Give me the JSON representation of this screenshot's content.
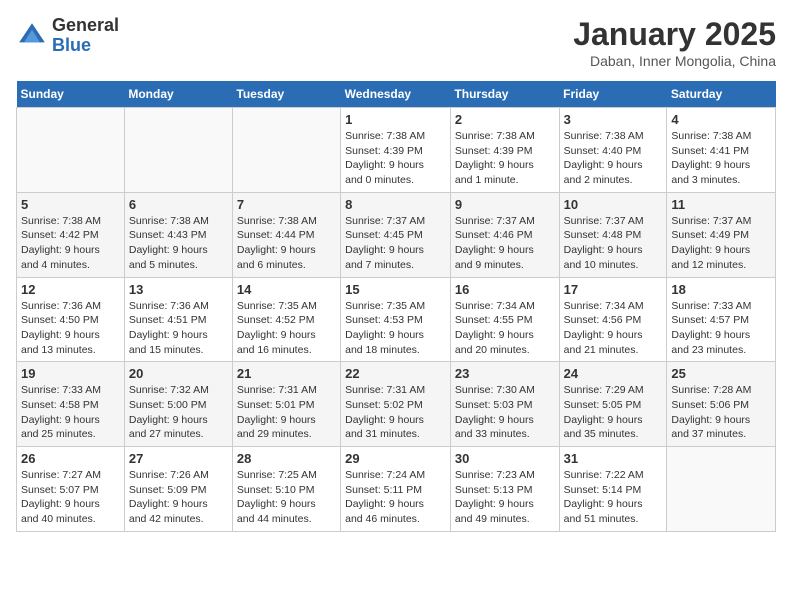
{
  "logo": {
    "general": "General",
    "blue": "Blue"
  },
  "title": "January 2025",
  "subtitle": "Daban, Inner Mongolia, China",
  "weekdays": [
    "Sunday",
    "Monday",
    "Tuesday",
    "Wednesday",
    "Thursday",
    "Friday",
    "Saturday"
  ],
  "weeks": [
    [
      {
        "day": "",
        "info": ""
      },
      {
        "day": "",
        "info": ""
      },
      {
        "day": "",
        "info": ""
      },
      {
        "day": "1",
        "info": "Sunrise: 7:38 AM\nSunset: 4:39 PM\nDaylight: 9 hours\nand 0 minutes."
      },
      {
        "day": "2",
        "info": "Sunrise: 7:38 AM\nSunset: 4:39 PM\nDaylight: 9 hours\nand 1 minute."
      },
      {
        "day": "3",
        "info": "Sunrise: 7:38 AM\nSunset: 4:40 PM\nDaylight: 9 hours\nand 2 minutes."
      },
      {
        "day": "4",
        "info": "Sunrise: 7:38 AM\nSunset: 4:41 PM\nDaylight: 9 hours\nand 3 minutes."
      }
    ],
    [
      {
        "day": "5",
        "info": "Sunrise: 7:38 AM\nSunset: 4:42 PM\nDaylight: 9 hours\nand 4 minutes."
      },
      {
        "day": "6",
        "info": "Sunrise: 7:38 AM\nSunset: 4:43 PM\nDaylight: 9 hours\nand 5 minutes."
      },
      {
        "day": "7",
        "info": "Sunrise: 7:38 AM\nSunset: 4:44 PM\nDaylight: 9 hours\nand 6 minutes."
      },
      {
        "day": "8",
        "info": "Sunrise: 7:37 AM\nSunset: 4:45 PM\nDaylight: 9 hours\nand 7 minutes."
      },
      {
        "day": "9",
        "info": "Sunrise: 7:37 AM\nSunset: 4:46 PM\nDaylight: 9 hours\nand 9 minutes."
      },
      {
        "day": "10",
        "info": "Sunrise: 7:37 AM\nSunset: 4:48 PM\nDaylight: 9 hours\nand 10 minutes."
      },
      {
        "day": "11",
        "info": "Sunrise: 7:37 AM\nSunset: 4:49 PM\nDaylight: 9 hours\nand 12 minutes."
      }
    ],
    [
      {
        "day": "12",
        "info": "Sunrise: 7:36 AM\nSunset: 4:50 PM\nDaylight: 9 hours\nand 13 minutes."
      },
      {
        "day": "13",
        "info": "Sunrise: 7:36 AM\nSunset: 4:51 PM\nDaylight: 9 hours\nand 15 minutes."
      },
      {
        "day": "14",
        "info": "Sunrise: 7:35 AM\nSunset: 4:52 PM\nDaylight: 9 hours\nand 16 minutes."
      },
      {
        "day": "15",
        "info": "Sunrise: 7:35 AM\nSunset: 4:53 PM\nDaylight: 9 hours\nand 18 minutes."
      },
      {
        "day": "16",
        "info": "Sunrise: 7:34 AM\nSunset: 4:55 PM\nDaylight: 9 hours\nand 20 minutes."
      },
      {
        "day": "17",
        "info": "Sunrise: 7:34 AM\nSunset: 4:56 PM\nDaylight: 9 hours\nand 21 minutes."
      },
      {
        "day": "18",
        "info": "Sunrise: 7:33 AM\nSunset: 4:57 PM\nDaylight: 9 hours\nand 23 minutes."
      }
    ],
    [
      {
        "day": "19",
        "info": "Sunrise: 7:33 AM\nSunset: 4:58 PM\nDaylight: 9 hours\nand 25 minutes."
      },
      {
        "day": "20",
        "info": "Sunrise: 7:32 AM\nSunset: 5:00 PM\nDaylight: 9 hours\nand 27 minutes."
      },
      {
        "day": "21",
        "info": "Sunrise: 7:31 AM\nSunset: 5:01 PM\nDaylight: 9 hours\nand 29 minutes."
      },
      {
        "day": "22",
        "info": "Sunrise: 7:31 AM\nSunset: 5:02 PM\nDaylight: 9 hours\nand 31 minutes."
      },
      {
        "day": "23",
        "info": "Sunrise: 7:30 AM\nSunset: 5:03 PM\nDaylight: 9 hours\nand 33 minutes."
      },
      {
        "day": "24",
        "info": "Sunrise: 7:29 AM\nSunset: 5:05 PM\nDaylight: 9 hours\nand 35 minutes."
      },
      {
        "day": "25",
        "info": "Sunrise: 7:28 AM\nSunset: 5:06 PM\nDaylight: 9 hours\nand 37 minutes."
      }
    ],
    [
      {
        "day": "26",
        "info": "Sunrise: 7:27 AM\nSunset: 5:07 PM\nDaylight: 9 hours\nand 40 minutes."
      },
      {
        "day": "27",
        "info": "Sunrise: 7:26 AM\nSunset: 5:09 PM\nDaylight: 9 hours\nand 42 minutes."
      },
      {
        "day": "28",
        "info": "Sunrise: 7:25 AM\nSunset: 5:10 PM\nDaylight: 9 hours\nand 44 minutes."
      },
      {
        "day": "29",
        "info": "Sunrise: 7:24 AM\nSunset: 5:11 PM\nDaylight: 9 hours\nand 46 minutes."
      },
      {
        "day": "30",
        "info": "Sunrise: 7:23 AM\nSunset: 5:13 PM\nDaylight: 9 hours\nand 49 minutes."
      },
      {
        "day": "31",
        "info": "Sunrise: 7:22 AM\nSunset: 5:14 PM\nDaylight: 9 hours\nand 51 minutes."
      },
      {
        "day": "",
        "info": ""
      }
    ]
  ]
}
